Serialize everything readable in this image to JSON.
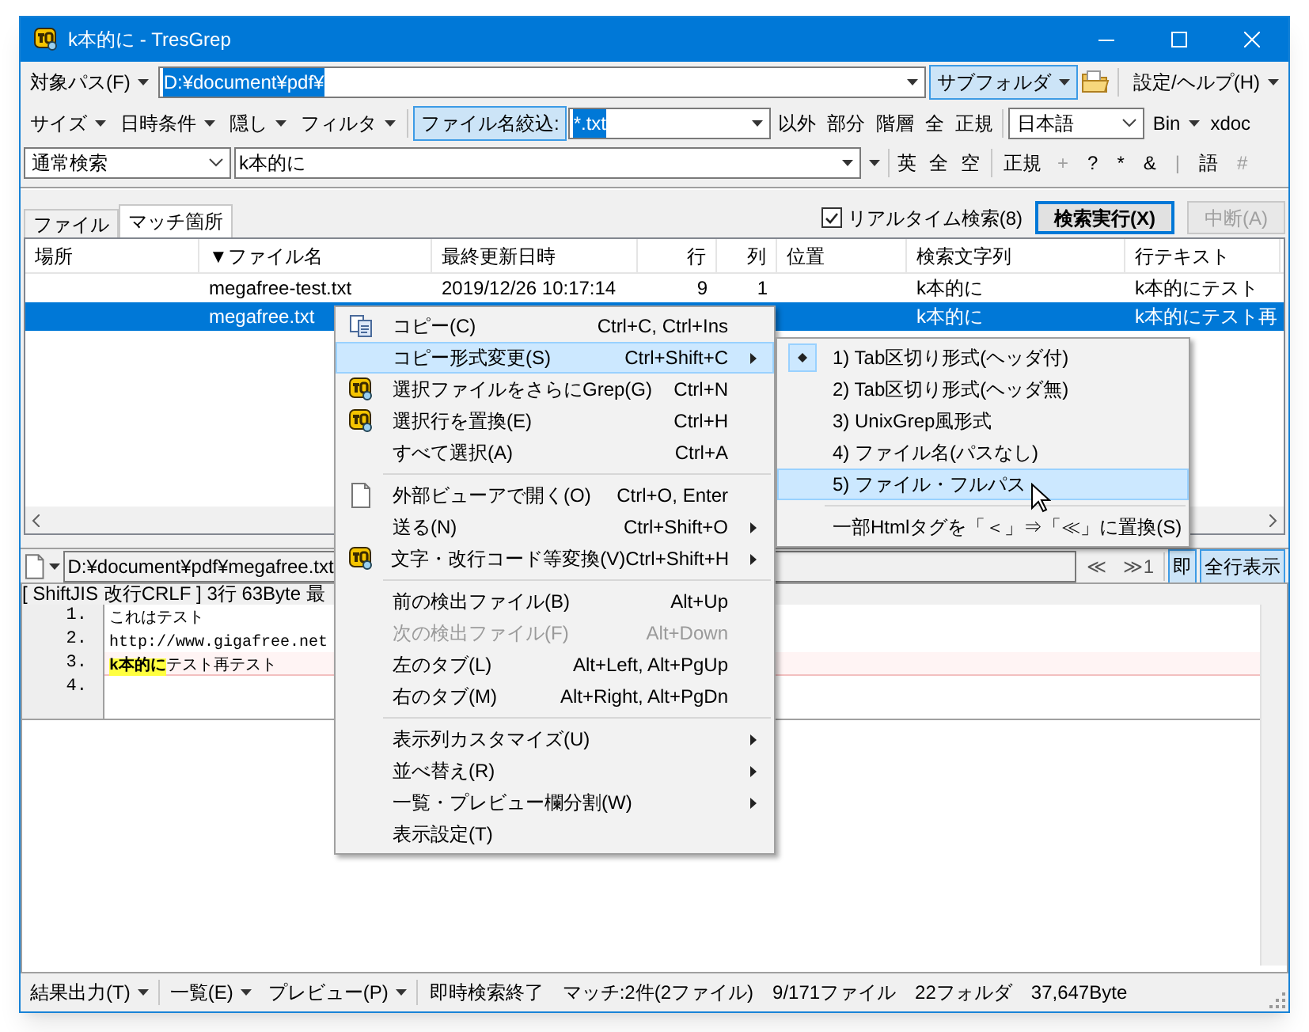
{
  "window": {
    "title": "k本的に - TresGrep"
  },
  "path_bar": {
    "label": "対象パス(F)",
    "value": "D:¥document¥pdf¥",
    "subfolder": {
      "label": "サブフォルダ",
      "on": true
    },
    "settings": "設定/ヘルプ(H)"
  },
  "filter_bar": {
    "menus": [
      "サイズ",
      "日時条件",
      "隠し",
      "フィルタ"
    ],
    "name_filter": {
      "label": "ファイル名絞込:",
      "on": true,
      "value": "*.txt"
    },
    "options": [
      "以外",
      "部分",
      "階層",
      "全",
      "正規"
    ],
    "encoding": "日本語",
    "bin": "Bin",
    "xdoc": "xdoc"
  },
  "search_bar": {
    "mode": "通常検索",
    "query": "k本的に",
    "options": [
      "英",
      "全",
      "空"
    ],
    "regex": "正規",
    "symbols": [
      {
        "label": "+",
        "disabled": true
      },
      {
        "label": "?",
        "disabled": false
      },
      {
        "label": "*",
        "disabled": false
      },
      {
        "label": "&",
        "disabled": false
      },
      {
        "label": "|",
        "disabled": true
      },
      {
        "label": "語",
        "disabled": false
      },
      {
        "label": "#",
        "disabled": true
      }
    ]
  },
  "tabs": [
    {
      "label": "ファイル",
      "selected": false
    },
    {
      "label": "マッチ箇所",
      "selected": true
    }
  ],
  "realtime": {
    "label": "リアルタイム検索(8)",
    "checked": true
  },
  "buttons": [
    {
      "label": "検索実行(X)",
      "disabled": false
    },
    {
      "label": "中断(A)",
      "disabled": true
    }
  ],
  "table": {
    "columns": [
      "場所",
      "▼ファイル名",
      "最終更新日時",
      "行",
      "列",
      "位置",
      "検索文字列",
      "行テキスト"
    ],
    "rows": [
      {
        "selected": false,
        "file": "megafree-test.txt",
        "modified": "2019/12/26 10:17:14",
        "line": "9",
        "col": "1",
        "match": "k本的に",
        "text": "k本的にテスト"
      },
      {
        "selected": true,
        "file": "megafree.txt",
        "match": "k本的に",
        "text": "k本的にテスト再"
      }
    ]
  },
  "preview": {
    "path": "D:¥document¥pdf¥megafree.txt",
    "nav": [
      "≪",
      "≫1"
    ],
    "instant": {
      "label": "即",
      "on": true
    },
    "all_lines": {
      "label": "全行表示",
      "on": true
    },
    "info": "[ ShiftJIS 改行CRLF ] 3行 63Byte 最",
    "lines": [
      {
        "number": "1.",
        "text": "これはテスト",
        "current": false
      },
      {
        "number": "2.",
        "text": "http://www.gigafree.net",
        "current": false
      },
      {
        "number": "3.",
        "highlight": "k本的に",
        "text": "テスト再テスト",
        "current": true
      },
      {
        "number": "4.",
        "current": false
      }
    ]
  },
  "context_menu": [
    {
      "kind": "copy",
      "label": "コピー(C)",
      "shortcut": "Ctrl+C, Ctrl+Ins",
      "submenu": false,
      "disabled": false,
      "selected": false
    },
    {
      "kind": "plain",
      "label": "コピー形式変更(S)",
      "shortcut": "Ctrl+Shift+C",
      "submenu": true,
      "disabled": false,
      "selected": true
    },
    {
      "kind": "app",
      "label": "選択ファイルをさらにGrep(G)",
      "shortcut": "Ctrl+N",
      "submenu": false,
      "disabled": false,
      "selected": false
    },
    {
      "kind": "app",
      "label": "選択行を置換(E)",
      "shortcut": "Ctrl+H",
      "submenu": false,
      "disabled": false,
      "selected": false
    },
    {
      "kind": "plain",
      "label": "すべて選択(A)",
      "shortcut": "Ctrl+A",
      "submenu": false,
      "disabled": false,
      "selected": false
    },
    {
      "kind": "separator"
    },
    {
      "kind": "file",
      "label": "外部ビューアで開く(O)",
      "shortcut": "Ctrl+O, Enter",
      "submenu": false,
      "disabled": false,
      "selected": false
    },
    {
      "kind": "plain",
      "label": "送る(N)",
      "shortcut": "Ctrl+Shift+O",
      "submenu": true,
      "disabled": false,
      "selected": false
    },
    {
      "kind": "app",
      "label": "文字・改行コード等変換(V)",
      "shortcut": "Ctrl+Shift+H",
      "submenu": true,
      "disabled": false,
      "selected": false
    },
    {
      "kind": "separator"
    },
    {
      "kind": "plain",
      "label": "前の検出ファイル(B)",
      "shortcut": "Alt+Up",
      "submenu": false,
      "disabled": false,
      "selected": false
    },
    {
      "kind": "plain",
      "label": "次の検出ファイル(F)",
      "shortcut": "Alt+Down",
      "submenu": false,
      "disabled": true,
      "selected": false
    },
    {
      "kind": "plain",
      "label": "左のタブ(L)",
      "shortcut": "Alt+Left, Alt+PgUp",
      "submenu": false,
      "disabled": false,
      "selected": false
    },
    {
      "kind": "plain",
      "label": "右のタブ(M)",
      "shortcut": "Alt+Right, Alt+PgDn",
      "submenu": false,
      "disabled": false,
      "selected": false
    },
    {
      "kind": "separator"
    },
    {
      "kind": "plain",
      "label": "表示列カスタマイズ(U)",
      "submenu": true,
      "disabled": false,
      "selected": false
    },
    {
      "kind": "plain",
      "label": "並べ替え(R)",
      "submenu": true,
      "disabled": false,
      "selected": false
    },
    {
      "kind": "plain",
      "label": "一覧・プレビュー欄分割(W)",
      "submenu": true,
      "disabled": false,
      "selected": false
    },
    {
      "kind": "plain",
      "label": "表示設定(T)",
      "submenu": false,
      "disabled": false,
      "selected": false
    }
  ],
  "submenu": [
    {
      "kind": "item",
      "label": "1) Tab区切り形式(ヘッダ付)",
      "checked": true,
      "selected": false
    },
    {
      "kind": "item",
      "label": "2) Tab区切り形式(ヘッダ無)",
      "checked": false,
      "selected": false
    },
    {
      "kind": "item",
      "label": "3) UnixGrep風形式",
      "checked": false,
      "selected": false
    },
    {
      "kind": "item",
      "label": "4) ファイル名(パスなし)",
      "checked": false,
      "selected": false
    },
    {
      "kind": "item",
      "label": "5) ファイル・フルパス",
      "checked": false,
      "selected": true
    },
    {
      "kind": "separator"
    },
    {
      "kind": "item",
      "label": "一部Htmlタグを「＜」⇒「≪」に置換(S)",
      "checked": false,
      "selected": false
    }
  ],
  "status_bar": {
    "menus": [
      "結果出力(T)",
      "一覧(E)",
      "プレビュー(P)"
    ],
    "texts": [
      "即時検索終了",
      "マッチ:2件(2ファイル)",
      "9/171ファイル",
      "22フォルダ",
      "37,647Byte"
    ]
  }
}
